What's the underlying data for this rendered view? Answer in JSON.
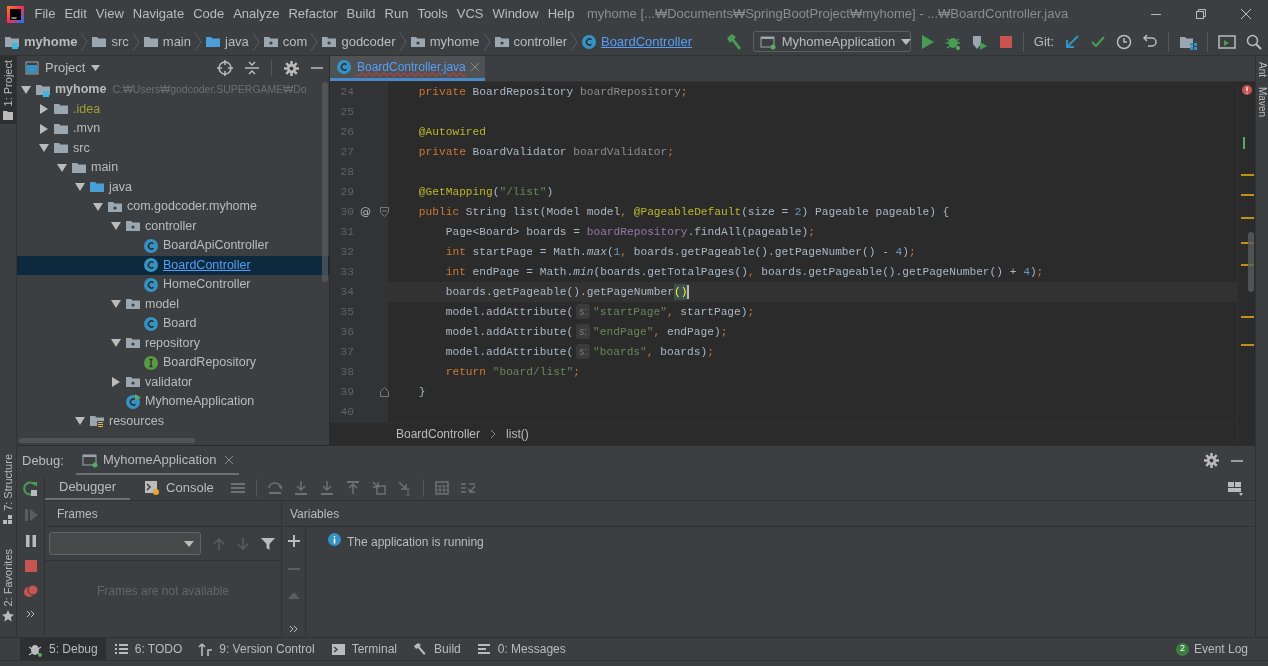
{
  "menu": [
    "File",
    "Edit",
    "View",
    "Navigate",
    "Code",
    "Analyze",
    "Refactor",
    "Build",
    "Run",
    "Tools",
    "VCS",
    "Window",
    "Help"
  ],
  "window": {
    "title": "myhome [...₩Documents₩SpringBootProject₩myhome] - ...₩BoardController.java"
  },
  "breadcrumbs": [
    {
      "label": "myhome",
      "kind": "module"
    },
    {
      "label": "src",
      "kind": "folder"
    },
    {
      "label": "main",
      "kind": "folder"
    },
    {
      "label": "java",
      "kind": "source"
    },
    {
      "label": "com",
      "kind": "package"
    },
    {
      "label": "godcoder",
      "kind": "package"
    },
    {
      "label": "myhome",
      "kind": "package"
    },
    {
      "label": "controller",
      "kind": "package"
    },
    {
      "label": "BoardController",
      "kind": "class"
    }
  ],
  "run_config": "MyhomeApplication",
  "git_label": "Git:",
  "left_strip": {
    "top": "1: Project",
    "middle": "7: Structure",
    "bottom": "2: Favorites"
  },
  "right_strip": [
    "Ant",
    "Maven"
  ],
  "project_panel": {
    "title": "Project",
    "tree": [
      {
        "label": "myhome",
        "kind": "module",
        "expanded": true,
        "selected": false,
        "path": "C:₩Users₩godcoder.SUPERGAME₩Do",
        "children": [
          {
            "label": ".idea",
            "kind": "folder",
            "expanded": false,
            "selected": false,
            "ignored": true
          },
          {
            "label": ".mvn",
            "kind": "folder",
            "expanded": false,
            "selected": false
          },
          {
            "label": "src",
            "kind": "folder",
            "expanded": true,
            "selected": false,
            "children": [
              {
                "label": "main",
                "kind": "folder",
                "expanded": true,
                "selected": false,
                "children": [
                  {
                    "label": "java",
                    "kind": "source",
                    "expanded": true,
                    "selected": false,
                    "children": [
                      {
                        "label": "com.godcoder.myhome",
                        "kind": "package",
                        "expanded": true,
                        "selected": false,
                        "children": [
                          {
                            "label": "controller",
                            "kind": "package",
                            "expanded": true,
                            "selected": false,
                            "children": [
                              {
                                "label": "BoardApiController",
                                "kind": "class",
                                "selected": false
                              },
                              {
                                "label": "BoardController",
                                "kind": "class",
                                "selected": true
                              },
                              {
                                "label": "HomeController",
                                "kind": "class",
                                "selected": false
                              }
                            ]
                          },
                          {
                            "label": "model",
                            "kind": "package",
                            "expanded": true,
                            "selected": false,
                            "children": [
                              {
                                "label": "Board",
                                "kind": "class",
                                "selected": false
                              }
                            ]
                          },
                          {
                            "label": "repository",
                            "kind": "package",
                            "expanded": true,
                            "selected": false,
                            "children": [
                              {
                                "label": "BoardRepository",
                                "kind": "interface",
                                "selected": false
                              }
                            ]
                          },
                          {
                            "label": "validator",
                            "kind": "package",
                            "expanded": false,
                            "selected": false
                          },
                          {
                            "label": "MyhomeApplication",
                            "kind": "app",
                            "selected": false
                          }
                        ]
                      }
                    ]
                  },
                  {
                    "label": "resources",
                    "kind": "resources",
                    "expanded": true,
                    "selected": false
                  }
                ]
              }
            ]
          }
        ]
      }
    ]
  },
  "editor": {
    "tab": {
      "label": "BoardController.java",
      "selected": true
    },
    "lines": [
      {
        "number": "24",
        "tokens": [
          {
            "kind": "kw",
            "text": "    private "
          },
          {
            "kind": "id",
            "text": "BoardRepository "
          },
          {
            "kind": "unused",
            "text": "boardRepository"
          },
          {
            "kind": "kw",
            "text": ";"
          }
        ]
      },
      {
        "number": "25"
      },
      {
        "number": "26",
        "tokens": [
          {
            "kind": "ann",
            "text": "    @Autowired"
          }
        ]
      },
      {
        "number": "27",
        "tokens": [
          {
            "kind": "kw",
            "text": "    private "
          },
          {
            "kind": "id",
            "text": "BoardValidator "
          },
          {
            "kind": "unused",
            "text": "boardValidator"
          },
          {
            "kind": "kw",
            "text": ";"
          }
        ]
      },
      {
        "number": "28"
      },
      {
        "number": "29",
        "tokens": [
          {
            "kind": "ann",
            "text": "    @GetMapping"
          },
          {
            "kind": "id",
            "text": "("
          },
          {
            "kind": "str",
            "text": "\"/list\""
          },
          {
            "kind": "id",
            "text": ")"
          }
        ]
      },
      {
        "number": "30",
        "marker": "@",
        "fold_start": true,
        "tokens": [
          {
            "kind": "kw",
            "text": "    public "
          },
          {
            "kind": "id",
            "text": "String list(Model model"
          },
          {
            "kind": "kw",
            "text": ", "
          },
          {
            "kind": "ann",
            "text": "@PageableDefault"
          },
          {
            "kind": "id",
            "text": "(size = "
          },
          {
            "kind": "num",
            "text": "2"
          },
          {
            "kind": "id",
            "text": ") Pageable pageable) {"
          }
        ]
      },
      {
        "number": "31",
        "tokens": [
          {
            "kind": "id",
            "text": "        Page<Board> boards = "
          },
          {
            "kind": "fld",
            "text": "boardRepository"
          },
          {
            "kind": "id",
            "text": ".findAll(pageable)"
          },
          {
            "kind": "kw",
            "text": ";"
          }
        ]
      },
      {
        "number": "32",
        "tokens": [
          {
            "kind": "kw",
            "text": "        int "
          },
          {
            "kind": "id",
            "text": "startPage = Math."
          },
          {
            "kind": "st",
            "text": "max"
          },
          {
            "kind": "id",
            "text": "("
          },
          {
            "kind": "num",
            "text": "1"
          },
          {
            "kind": "kw",
            "text": ", "
          },
          {
            "kind": "id",
            "text": "boards.getPageable().getPageNumber() - "
          },
          {
            "kind": "num",
            "text": "4"
          },
          {
            "kind": "id",
            "text": ")"
          },
          {
            "kind": "kw",
            "text": ";"
          }
        ]
      },
      {
        "number": "33",
        "tokens": [
          {
            "kind": "kw",
            "text": "        int "
          },
          {
            "kind": "id",
            "text": "endPage = Math."
          },
          {
            "kind": "st",
            "text": "min"
          },
          {
            "kind": "id",
            "text": "(boards.getTotalPages()"
          },
          {
            "kind": "kw",
            "text": ", "
          },
          {
            "kind": "id",
            "text": "boards.getPageable().getPageNumber() + "
          },
          {
            "kind": "num",
            "text": "4"
          },
          {
            "kind": "id",
            "text": ")"
          },
          {
            "kind": "kw",
            "text": ";"
          }
        ]
      },
      {
        "number": "34",
        "current": true,
        "tokens": [
          {
            "kind": "id",
            "text": "        boards.getPageable().getPageNumber"
          },
          {
            "kind": "match",
            "text": "()"
          }
        ]
      },
      {
        "number": "35",
        "tokens": [
          {
            "kind": "id",
            "text": "        model.addAttribute("
          },
          {
            "kind": "hint",
            "text": "s:"
          },
          {
            "kind": "str",
            "text": "\"startPage\""
          },
          {
            "kind": "kw",
            "text": ", "
          },
          {
            "kind": "id",
            "text": "startPage)"
          },
          {
            "kind": "kw",
            "text": ";"
          }
        ]
      },
      {
        "number": "36",
        "tokens": [
          {
            "kind": "id",
            "text": "        model.addAttribute("
          },
          {
            "kind": "hint",
            "text": "s:"
          },
          {
            "kind": "str",
            "text": "\"endPage\""
          },
          {
            "kind": "kw",
            "text": ", "
          },
          {
            "kind": "id",
            "text": "endPage)"
          },
          {
            "kind": "kw",
            "text": ";"
          }
        ]
      },
      {
        "number": "37",
        "tokens": [
          {
            "kind": "id",
            "text": "        model.addAttribute("
          },
          {
            "kind": "hint",
            "text": "s:"
          },
          {
            "kind": "str",
            "text": "\"boards\""
          },
          {
            "kind": "kw",
            "text": ", "
          },
          {
            "kind": "id",
            "text": "boards)"
          },
          {
            "kind": "kw",
            "text": ";"
          }
        ]
      },
      {
        "number": "38",
        "tokens": [
          {
            "kind": "kw",
            "text": "        return "
          },
          {
            "kind": "str",
            "text": "\"board/list\""
          },
          {
            "kind": "kw",
            "text": ";"
          }
        ]
      },
      {
        "number": "39",
        "fold_end": true,
        "tokens": [
          {
            "kind": "id",
            "text": "    }"
          }
        ]
      },
      {
        "number": "40"
      }
    ],
    "breadcrumb": [
      "BoardController",
      "list()"
    ]
  },
  "debug": {
    "title": "Debug:",
    "session": "MyhomeApplication",
    "tabs": [
      {
        "label": "Debugger",
        "selected": true
      },
      {
        "label": "Console",
        "selected": false
      }
    ],
    "frames_title": "Frames",
    "frames_empty": "Frames are not available",
    "variables_title": "Variables",
    "message": "The application is running"
  },
  "tool_tabs": [
    {
      "label": "5: Debug",
      "kind": "debug",
      "selected": true
    },
    {
      "label": "6: TODO",
      "kind": "todo",
      "selected": false
    },
    {
      "label": "9: Version Control",
      "kind": "vcs",
      "selected": false
    },
    {
      "label": "Terminal",
      "kind": "terminal",
      "selected": false
    },
    {
      "label": "Build",
      "kind": "build",
      "selected": false
    },
    {
      "label": "0: Messages",
      "kind": "messages",
      "selected": false
    }
  ],
  "event_log": {
    "count": "2",
    "label": "Event Log"
  }
}
